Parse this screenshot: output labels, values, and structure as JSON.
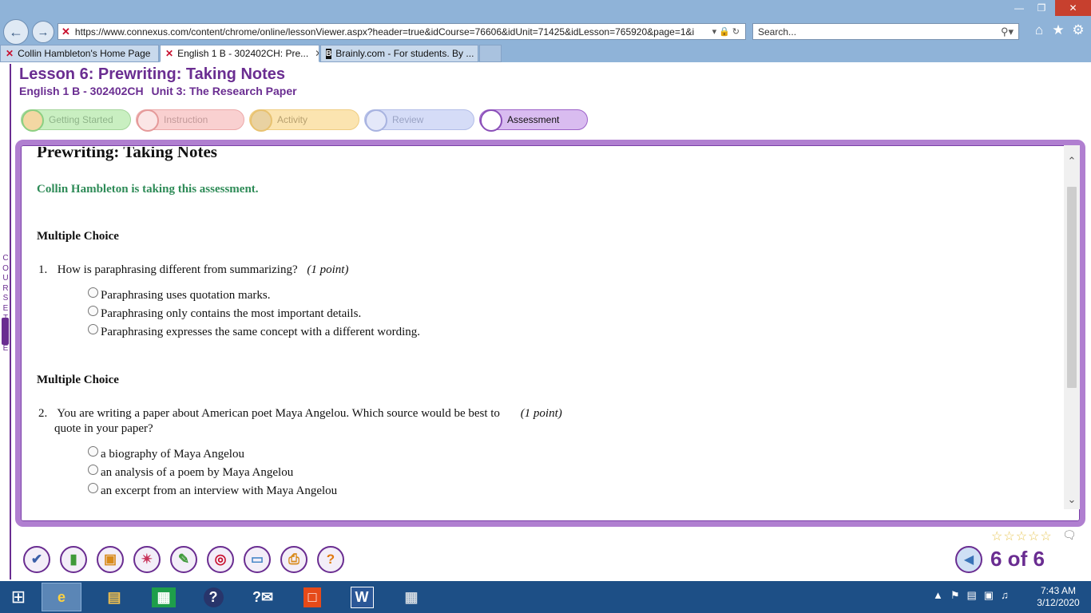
{
  "browser": {
    "url": "https://www.connexus.com/content/chrome/online/lessonViewer.aspx?header=true&idCourse=76606&idUnit=71425&idLesson=765920&page=1&i",
    "search_placeholder": "Search...",
    "tabs": [
      {
        "label": "Collin Hambleton's Home Page",
        "active": false
      },
      {
        "label": "English 1 B - 302402CH: Pre...",
        "active": true
      },
      {
        "label": "Brainly.com - For students. By ...",
        "active": false
      }
    ]
  },
  "lesson": {
    "title": "Lesson 6: Prewriting: Taking Notes",
    "course": "English 1 B - 302402CH",
    "unit": "Unit 3: The Research Paper",
    "steps": [
      "Getting Started",
      "Instruction",
      "Activity",
      "Review",
      "Assessment"
    ]
  },
  "sidebar": {
    "course_tree_label": "COURSE TREE"
  },
  "assessment": {
    "page_heading": "Prewriting: Taking Notes",
    "taking_notice": "Collin Hambleton is taking this assessment.",
    "questions": [
      {
        "section": "Multiple Choice",
        "number": "1.",
        "text": "How is paraphrasing different from summarizing?",
        "points": "(1 point)",
        "options": [
          "Paraphrasing uses quotation marks.",
          "Paraphrasing only contains the most important details.",
          "Paraphrasing expresses the same concept with a different wording."
        ]
      },
      {
        "section": "Multiple Choice",
        "number": "2.",
        "text_line1": "You are writing a paper about American poet Maya Angelou. Which source would be best to",
        "text_line2": "quote in your paper?",
        "points": "(1 point)",
        "options": [
          "a biography of Maya Angelou",
          "an analysis of a poem by Maya Angelou",
          "an excerpt from an interview with Maya Angelou"
        ]
      }
    ]
  },
  "footer": {
    "page_count": "6 of 6"
  },
  "taskbar": {
    "time": "7:43 AM",
    "date": "3/12/2020"
  },
  "colors": {
    "brand_purple": "#6a2d91",
    "notice_green": "#2e8b57",
    "taskbar": "#1d4f86"
  }
}
